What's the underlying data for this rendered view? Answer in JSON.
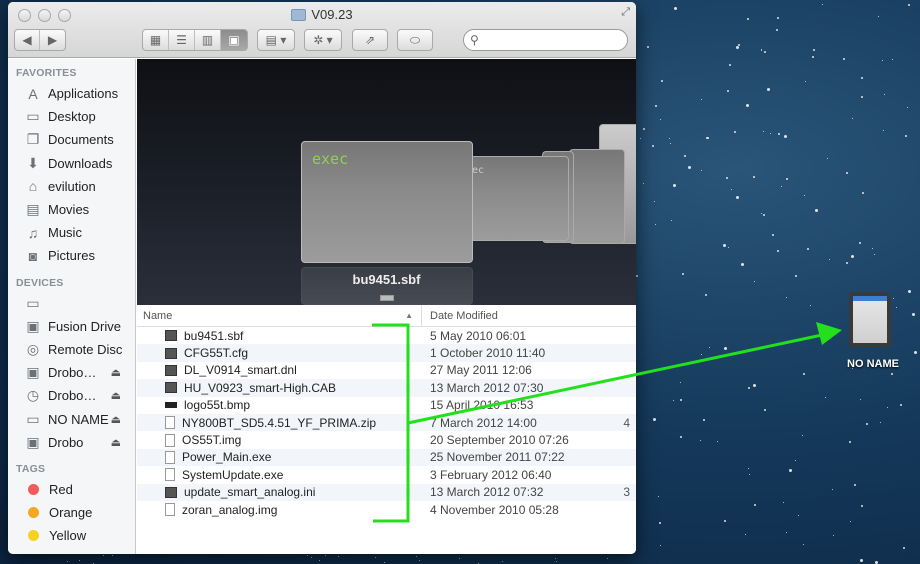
{
  "window": {
    "title": "V09.23"
  },
  "toolbar": {
    "back_icon": "◀",
    "forward_icon": "▶",
    "view_icons": [
      "▦",
      "☰",
      "▥",
      "▣"
    ],
    "arrange_icon": "▤ ▾",
    "action_icon": "✲ ▾",
    "share_icon": "⇗",
    "tags_icon": "⬭",
    "search_placeholder": ""
  },
  "sidebar": {
    "favorites_header": "FAVORITES",
    "favorites": [
      {
        "label": "Applications",
        "icon": "applications-icon",
        "glyph": "A"
      },
      {
        "label": "Desktop",
        "icon": "desktop-icon",
        "glyph": "▭"
      },
      {
        "label": "Documents",
        "icon": "documents-icon",
        "glyph": "❐"
      },
      {
        "label": "Downloads",
        "icon": "downloads-icon",
        "glyph": "⬇"
      },
      {
        "label": "evilution",
        "icon": "home-icon",
        "glyph": "⌂"
      },
      {
        "label": "Movies",
        "icon": "movies-icon",
        "glyph": "▤"
      },
      {
        "label": "Music",
        "icon": "music-icon",
        "glyph": "♫"
      },
      {
        "label": "Pictures",
        "icon": "pictures-icon",
        "glyph": "◙"
      }
    ],
    "devices_header": "DEVICES",
    "devices": [
      {
        "label": "",
        "icon": "computer-icon",
        "glyph": "▭",
        "eject": false
      },
      {
        "label": "Fusion Drive",
        "icon": "hard-drive-icon",
        "glyph": "▣",
        "eject": false
      },
      {
        "label": "Remote Disc",
        "icon": "disc-icon",
        "glyph": "◎",
        "eject": false
      },
      {
        "label": "Drobo…",
        "icon": "drive-icon",
        "glyph": "▣",
        "eject": true
      },
      {
        "label": "Drobo…",
        "icon": "time-machine-drive-icon",
        "glyph": "◷",
        "eject": true
      },
      {
        "label": "NO NAME",
        "icon": "sd-card-icon",
        "glyph": "▭",
        "eject": true
      },
      {
        "label": "Drobo",
        "icon": "drive-icon",
        "glyph": "▣",
        "eject": true
      }
    ],
    "eject_glyph": "⏏",
    "tags_header": "TAGS",
    "tags": [
      {
        "label": "Red",
        "color": "#f25b5b"
      },
      {
        "label": "Orange",
        "color": "#f5a623"
      },
      {
        "label": "Yellow",
        "color": "#f4d21f"
      }
    ]
  },
  "coverflow": {
    "card_text": "exec",
    "card_text_side": "ec",
    "selected_label": "bu9451.sbf",
    "accent": "#8fd14f"
  },
  "list": {
    "col_name": "Name",
    "col_date": "Date Modified",
    "sort_glyph": "▲",
    "rows": [
      {
        "name": "bu9451.sbf",
        "date": "5 May 2010 06:01",
        "size": "",
        "icon": "dark"
      },
      {
        "name": "CFG55T.cfg",
        "date": "1 October 2010 11:40",
        "size": "",
        "icon": "dark"
      },
      {
        "name": "DL_V0914_smart.dnl",
        "date": "27 May 2011 12:06",
        "size": "",
        "icon": "dark"
      },
      {
        "name": "HU_V0923_smart-High.CAB",
        "date": "13 March 2012 07:30",
        "size": "",
        "icon": "dark"
      },
      {
        "name": "logo55t.bmp",
        "date": "15 April 2010 16:53",
        "size": "",
        "icon": "bmp"
      },
      {
        "name": "NY800BT_SD5.4.51_YF_PRIMA.zip",
        "date": "7 March 2012 14:00",
        "size": "4",
        "icon": "page"
      },
      {
        "name": "OS55T.img",
        "date": "20 September 2010 07:26",
        "size": "",
        "icon": "page"
      },
      {
        "name": "Power_Main.exe",
        "date": "25 November 2011 07:22",
        "size": "",
        "icon": "page"
      },
      {
        "name": "SystemUpdate.exe",
        "date": "3 February 2012 06:40",
        "size": "",
        "icon": "page"
      },
      {
        "name": "update_smart_analog.ini",
        "date": "13 March 2012 07:32",
        "size": "3",
        "icon": "dark"
      },
      {
        "name": "zoran_analog.img",
        "date": "4 November 2010 05:28",
        "size": "",
        "icon": "page"
      }
    ]
  },
  "desktop": {
    "volume_label": "NO NAME"
  },
  "annotation": {
    "color": "#22e01c"
  }
}
